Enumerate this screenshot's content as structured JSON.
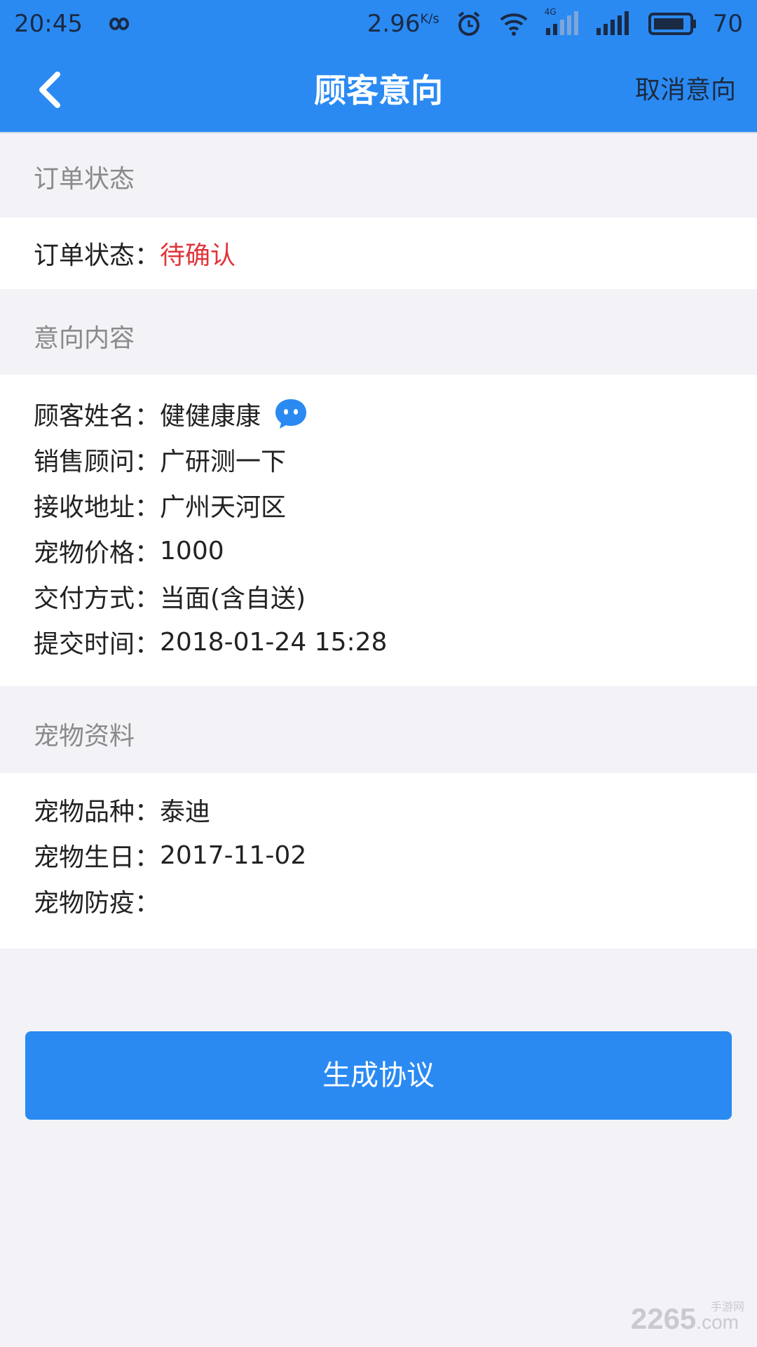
{
  "status_bar": {
    "time": "20:45",
    "network_speed": "2.96",
    "network_unit": "K/s",
    "battery": "70",
    "network_type": "4G",
    "icons": [
      "infinity-icon",
      "alarm-icon",
      "wifi-icon",
      "signal-icon",
      "signal-icon",
      "battery-icon"
    ]
  },
  "nav": {
    "title": "顾客意向",
    "action": "取消意向"
  },
  "sections": {
    "order_status": {
      "header": "订单状态",
      "label": "订单状态：",
      "value": "待确认"
    },
    "intent": {
      "header": "意向内容",
      "rows": [
        {
          "label": "顾客姓名：",
          "value": "健健康康"
        },
        {
          "label": "销售顾问：",
          "value": "广研测一下"
        },
        {
          "label": "接收地址：",
          "value": "广州天河区"
        },
        {
          "label": "宠物价格：",
          "value": "1000"
        },
        {
          "label": "交付方式：",
          "value": "当面(含自送)"
        },
        {
          "label": "提交时间：",
          "value": "2018-01-24 15:28"
        }
      ]
    },
    "pet": {
      "header": "宠物资料",
      "rows": [
        {
          "label": "宠物品种：",
          "value": "泰迪"
        },
        {
          "label": "宠物生日：",
          "value": "2017-11-02"
        },
        {
          "label": "宠物防疫：",
          "value": ""
        }
      ]
    }
  },
  "button": {
    "label": "生成协议"
  },
  "watermark": {
    "main": "2265",
    "suffix": ".com",
    "tag": "手游网"
  },
  "colors": {
    "primary": "#2a8af2",
    "status_pending": "#e0353b",
    "background": "#f2f2f7"
  }
}
